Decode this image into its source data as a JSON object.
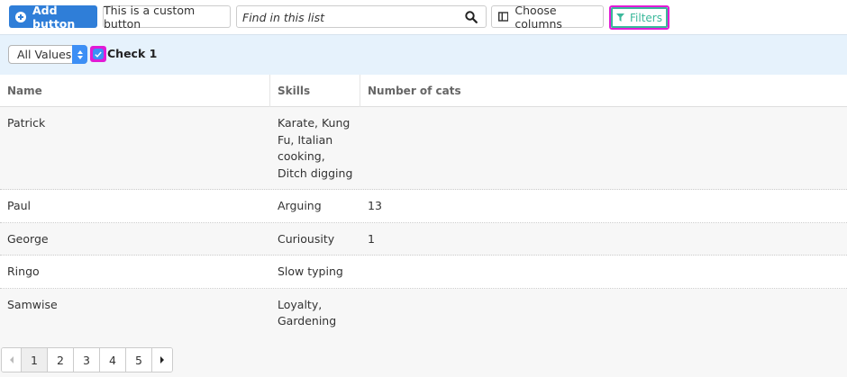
{
  "toolbar": {
    "add_button_label": "Add button",
    "custom_button_label": "This is a custom button",
    "search_placeholder": "Find in this list",
    "choose_columns_label": "Choose columns",
    "filters_label": "Filters"
  },
  "filter_bar": {
    "select_value": "All Values",
    "checkbox_label": "Check 1",
    "checkbox_checked": true
  },
  "table": {
    "headers": [
      "Name",
      "Skills",
      "Number of cats"
    ],
    "rows": [
      {
        "name": "Patrick",
        "skills": "Karate, Kung Fu, Italian cooking, Ditch digging",
        "cats": ""
      },
      {
        "name": "Paul",
        "skills": "Arguing",
        "cats": "13"
      },
      {
        "name": "George",
        "skills": "Curiousity",
        "cats": "1"
      },
      {
        "name": "Ringo",
        "skills": "Slow typing",
        "cats": ""
      },
      {
        "name": "Samwise",
        "skills": "Loyalty, Gardening",
        "cats": ""
      }
    ]
  },
  "pagination": {
    "pages": [
      "1",
      "2",
      "3",
      "4",
      "5"
    ],
    "current": "1"
  },
  "colors": {
    "primary": "#2f7ed8",
    "filters_accent": "#3bb89b",
    "highlight": "#e11bd6",
    "filter_bar_bg": "#e6f2fc"
  }
}
